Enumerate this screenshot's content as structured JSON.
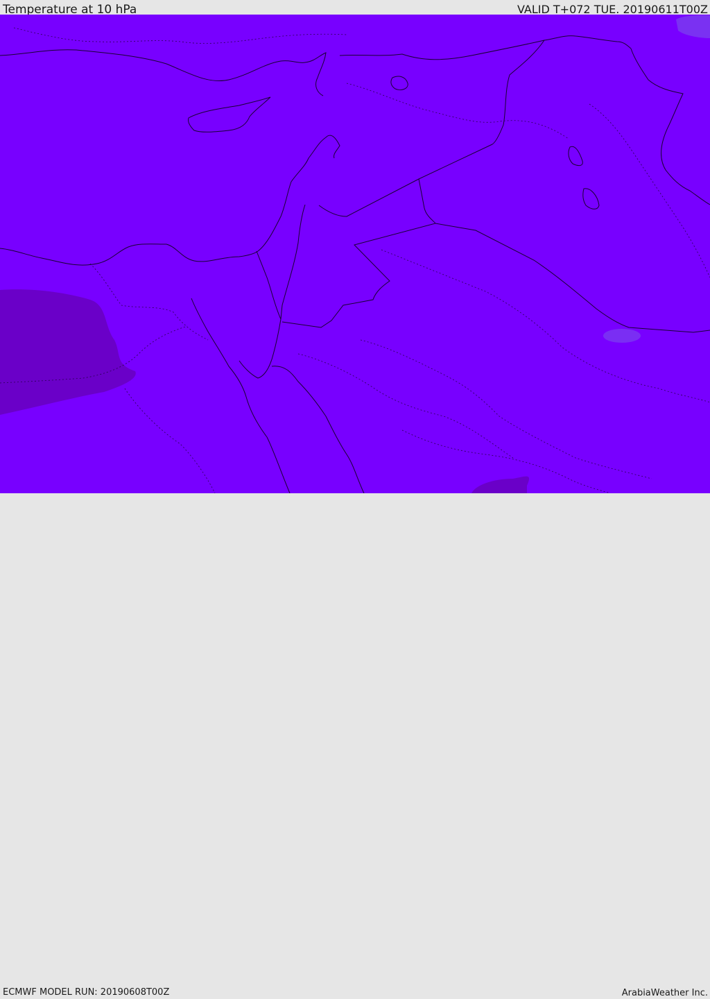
{
  "header": {
    "title": "Temperature at 10 hPa",
    "valid": "VALID T+072 TUE. 20190611T00Z"
  },
  "footer": {
    "model_run": "ECMWF MODEL RUN: 20190608T00Z",
    "credit": "ArabiaWeather Inc."
  },
  "map": {
    "field_color": "#7800FF",
    "warm_patch_color": "#6A00C8",
    "cool_patch_color": "#7A3AF0",
    "border_color": "#1a0033"
  }
}
